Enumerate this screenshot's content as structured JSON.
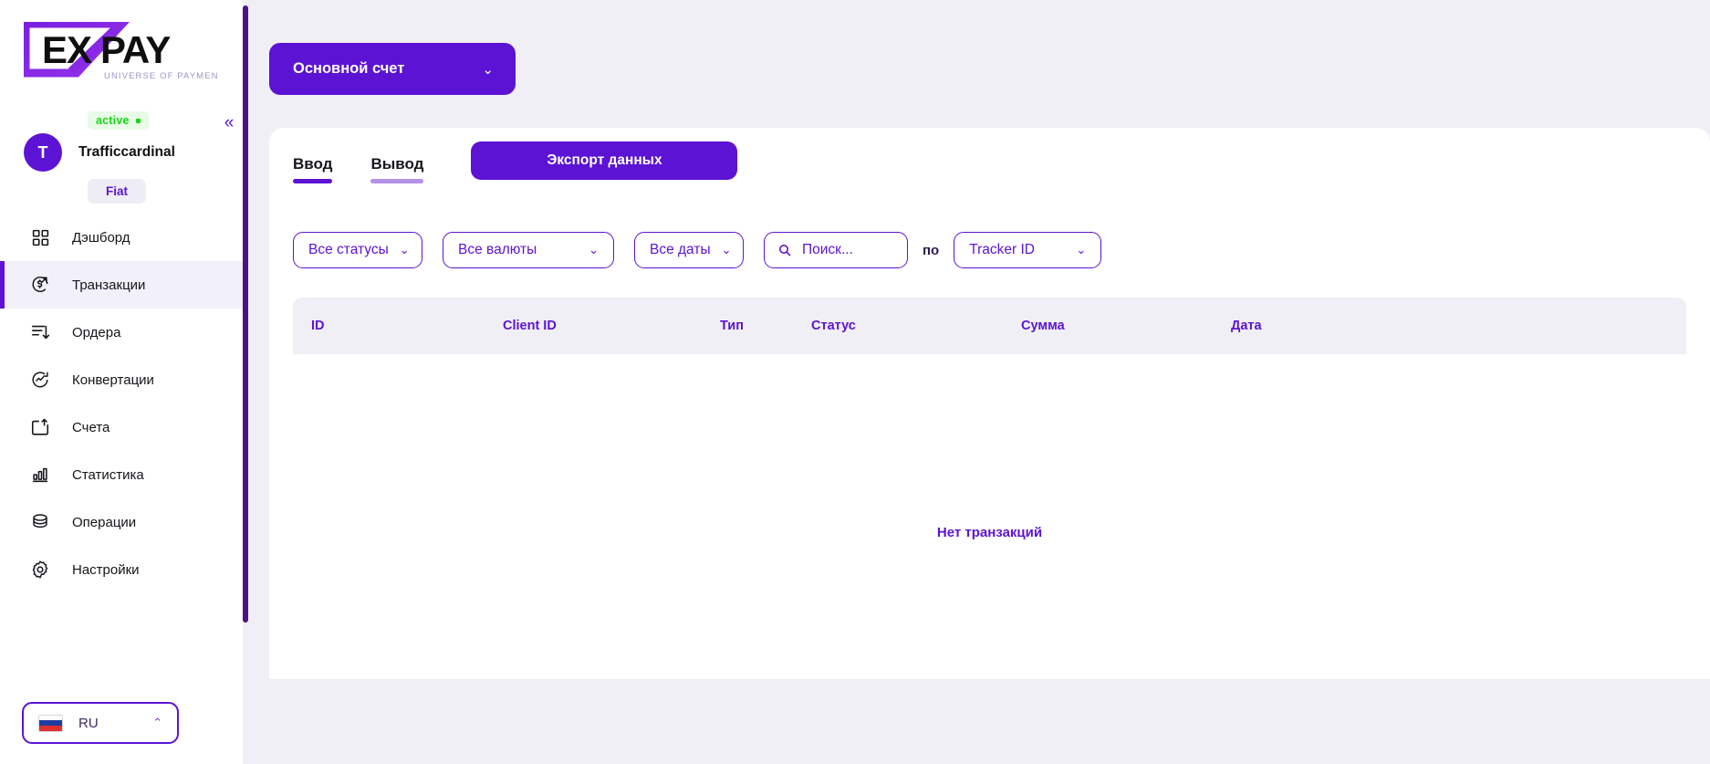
{
  "brand": {
    "logo_text": "EXPAY",
    "logo_tagline": "UNIVERSE OF PAYMENTS",
    "accent": "#5c13d4",
    "accent_dark": "#4a1388",
    "page_bg": "#f0eff5"
  },
  "sidebar": {
    "collapse_icon": "«",
    "status_badge": {
      "label": "active"
    },
    "user": {
      "initial": "T",
      "name": "Trafficcardinal"
    },
    "account_type_chip": "Fiat",
    "items": [
      {
        "label": "Дэшборд",
        "icon": "grid-icon",
        "active": false
      },
      {
        "label": "Транзакции",
        "icon": "transaction-icon",
        "active": true
      },
      {
        "label": "Ордера",
        "icon": "orders-icon",
        "active": false
      },
      {
        "label": "Конвертации",
        "icon": "conversion-icon",
        "active": false
      },
      {
        "label": "Счета",
        "icon": "invoice-icon",
        "active": false
      },
      {
        "label": "Статистика",
        "icon": "chart-bar-icon",
        "active": false
      },
      {
        "label": "Операции",
        "icon": "coins-icon",
        "active": false
      },
      {
        "label": "Настройки",
        "icon": "gear-icon",
        "active": false
      }
    ],
    "language": {
      "code": "RU",
      "flag": "russia-flag-icon",
      "caret": "⌃"
    }
  },
  "header": {
    "account_selector": {
      "label": "Основной счет",
      "caret": "⌄"
    }
  },
  "main": {
    "tabs": [
      {
        "label": "Ввод",
        "active": true
      },
      {
        "label": "Вывод",
        "active": false
      }
    ],
    "export_button": "Экспорт данных",
    "filters": {
      "status": {
        "label": "Все статусы",
        "caret": "⌄"
      },
      "currency": {
        "label": "Все валюты",
        "caret": "⌄"
      },
      "dates": {
        "label": "Все даты",
        "caret": "⌄"
      },
      "search": {
        "placeholder": "Поиск...",
        "value": "",
        "icon": "search-icon"
      },
      "by_label": "по",
      "tracker": {
        "label": "Tracker ID",
        "caret": "⌄"
      }
    },
    "table": {
      "columns": [
        "ID",
        "Client ID",
        "Тип",
        "Статус",
        "Сумма",
        "Дата"
      ],
      "rows": [],
      "empty_message": "Нет транзакций"
    }
  }
}
